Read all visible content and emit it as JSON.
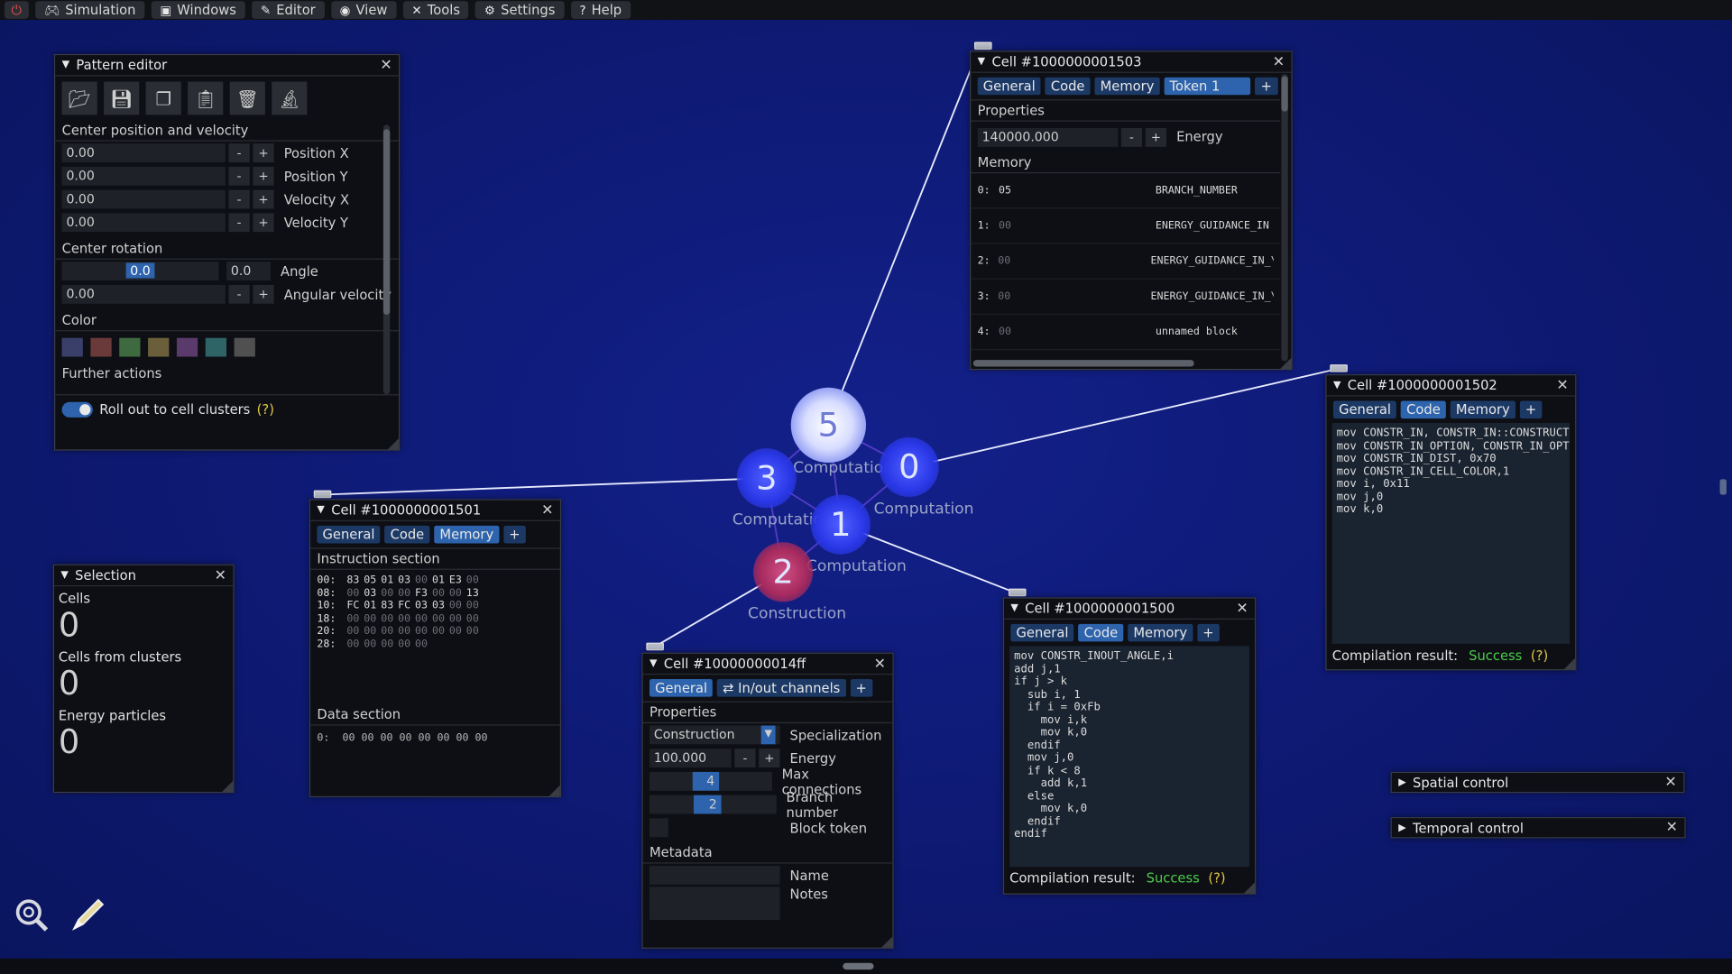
{
  "menubar": {
    "items": [
      {
        "icon": "gamepad-icon",
        "label": "Simulation"
      },
      {
        "icon": "windows-icon",
        "label": "Windows"
      },
      {
        "icon": "pencil-icon",
        "label": "Editor"
      },
      {
        "icon": "eye-icon",
        "label": "View"
      },
      {
        "icon": "tools-icon",
        "label": "Tools"
      },
      {
        "icon": "gear-icon",
        "label": "Settings"
      },
      {
        "icon": "help-icon",
        "label": "Help"
      }
    ]
  },
  "pattern_editor": {
    "title": "Pattern editor",
    "section_pos": "Center position and velocity",
    "pos_x": "0.00",
    "pos_x_label": "Position X",
    "pos_y": "0.00",
    "pos_y_label": "Position Y",
    "vel_x": "0.00",
    "vel_x_label": "Velocity X",
    "vel_y": "0.00",
    "vel_y_label": "Velocity Y",
    "section_rot": "Center rotation",
    "angle_slider": "0.0",
    "angle_value": "0.0",
    "angle_label": "Angle",
    "ang_vel": "0.00",
    "ang_vel_label": "Angular velocity",
    "section_color": "Color",
    "colors": [
      "#3a3f6a",
      "#6a3a3a",
      "#3f6a3f",
      "#6a5f3a",
      "#5a3a6a",
      "#2f6466",
      "#505050"
    ],
    "further_actions": "Further actions",
    "rollout_label": "Roll out to cell clusters",
    "help": "(?)"
  },
  "selection": {
    "title": "Selection",
    "cells_label": "Cells",
    "cells_value": "0",
    "clusters_label": "Cells from clusters",
    "clusters_value": "0",
    "particles_label": "Energy particles",
    "particles_value": "0"
  },
  "cell1501": {
    "title": "Cell #1000000001501",
    "tabs": [
      "General",
      "Code",
      "Memory",
      "+"
    ],
    "instr_section": "Instruction section",
    "rows": [
      {
        "addr": "00:",
        "bytes": [
          "83",
          "05",
          "01",
          "03",
          "00",
          "01",
          "E3",
          "00"
        ]
      },
      {
        "addr": "08:",
        "bytes": [
          "00",
          "03",
          "00",
          "00",
          "F3",
          "00",
          "00",
          "13"
        ]
      },
      {
        "addr": "10:",
        "bytes": [
          "FC",
          "01",
          "83",
          "FC",
          "03",
          "03",
          "00",
          "00"
        ]
      },
      {
        "addr": "18:",
        "bytes": [
          "00",
          "00",
          "00",
          "00",
          "00",
          "00",
          "00",
          "00"
        ]
      },
      {
        "addr": "20:",
        "bytes": [
          "00",
          "00",
          "00",
          "00",
          "00",
          "00",
          "00",
          "00"
        ]
      },
      {
        "addr": "28:",
        "bytes": [
          "00",
          "00",
          "00",
          "00",
          "00"
        ]
      }
    ],
    "data_section": "Data section",
    "data_row": "0:  00 00 00 00 00 00 00 00"
  },
  "cell14ff": {
    "title": "Cell #10000000014ff",
    "tabs": [
      "General",
      "In/out channels",
      "+"
    ],
    "properties": "Properties",
    "specialization": "Construction",
    "specialization_label": "Specialization",
    "energy": "100.000",
    "energy_label": "Energy",
    "max_conn": "4",
    "max_conn_label": "Max connections",
    "max_conn_fill": 0.5,
    "branch": "2",
    "branch_label": "Branch number",
    "branch_fill": 0.5,
    "block_token_label": "Block token",
    "metadata": "Metadata",
    "name_label": "Name",
    "notes_label": "Notes"
  },
  "cell1503": {
    "title": "Cell #1000000001503",
    "tabs": [
      "General",
      "Code",
      "Memory",
      "Token 1",
      "+"
    ],
    "properties": "Properties",
    "energy": "140000.000",
    "energy_label": "Energy",
    "memory": "Memory",
    "mem_rows": [
      {
        "idx": "0:",
        "val": "05",
        "name": "BRANCH_NUMBER"
      },
      {
        "idx": "1:",
        "val": "00",
        "name": "ENERGY_GUIDANCE_IN"
      },
      {
        "idx": "2:",
        "val": "00",
        "name": "ENERGY_GUIDANCE_IN_\\"
      },
      {
        "idx": "3:",
        "val": "00",
        "name": "ENERGY_GUIDANCE_IN_\\"
      },
      {
        "idx": "4:",
        "val": "00",
        "name": "unnamed block"
      }
    ]
  },
  "cell1502": {
    "title": "Cell #1000000001502",
    "tabs": [
      "General",
      "Code",
      "Memory",
      "+"
    ],
    "code": "mov CONSTR_IN, CONSTR_IN::CONSTRUCT\nmov CONSTR_IN_OPTION, CONSTR_IN_OPTIO\nmov CONSTR_IN_DIST, 0x70\nmov CONSTR_IN_CELL_COLOR,1\nmov i, 0x11\nmov j,0\nmov k,0",
    "compile_label": "Compilation result:",
    "compile_result": "Success",
    "help": "(?)"
  },
  "cell1500": {
    "title": "Cell #1000000001500",
    "tabs": [
      "General",
      "Code",
      "Memory",
      "+"
    ],
    "code": "mov CONSTR_INOUT_ANGLE,i\nadd j,1\nif j > k\n  sub i, 1\n  if i = 0xFb\n    mov i,k\n    mov k,0\n  endif\n  mov j,0\n  if k < 8\n    add k,1\n  else\n    mov k,0\n  endif\nendif",
    "compile_label": "Compilation result:",
    "compile_result": "Success",
    "help": "(?)"
  },
  "spatial": {
    "title": "Spatial control"
  },
  "temporal": {
    "title": "Temporal control"
  },
  "graph": {
    "nodes": [
      {
        "id": "5",
        "label": "Computation"
      },
      {
        "id": "0",
        "label": "Computation"
      },
      {
        "id": "3",
        "label": "Computation"
      },
      {
        "id": "1",
        "label": "Computation"
      },
      {
        "id": "2",
        "label": "Construction"
      }
    ]
  }
}
